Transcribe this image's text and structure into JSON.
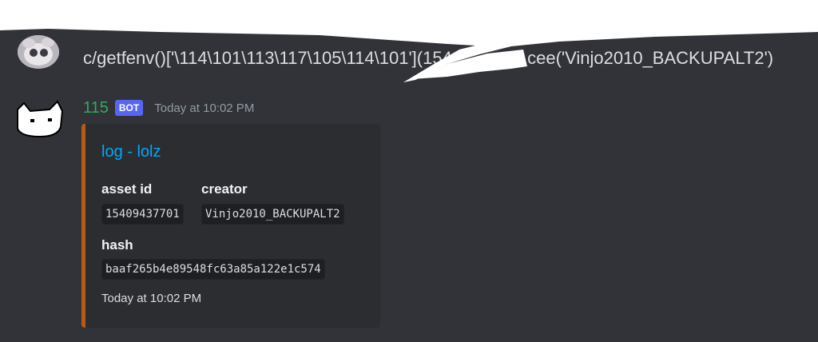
{
  "message1": {
    "text": "c/getfenv()['\\114\\101\\113\\117\\105\\114\\101'](154",
    "text_tail": ".cee('Vinjo2010_BACKUPALT2')"
  },
  "bot_message": {
    "username": "115",
    "badge": "BOT",
    "timestamp": "Today at 10:02 PM",
    "embed": {
      "accent_color": "#b65b17",
      "title": "log - lolz",
      "fields": [
        {
          "name": "asset id",
          "value": "15409437701"
        },
        {
          "name": "creator",
          "value": "Vinjo2010_BACKUPALT2"
        },
        {
          "name": "hash",
          "value": "baaf265b4e89548fc63a85a122e1c574"
        }
      ],
      "footer": "Today at 10:02 PM"
    }
  },
  "colors": {
    "background": "#313338",
    "username": "#3ba55d",
    "badge": "#5865f2",
    "link": "#00a8fc"
  }
}
